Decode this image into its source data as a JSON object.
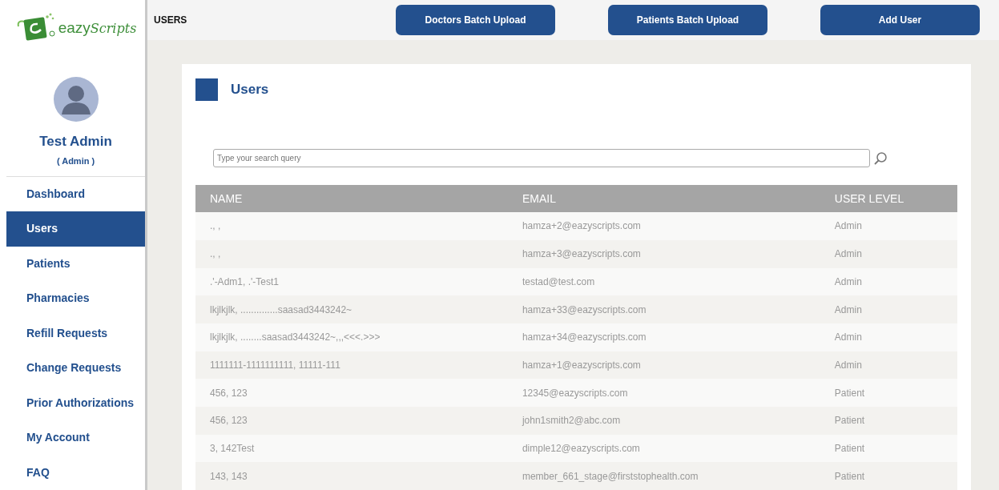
{
  "logo": {
    "text": "eazy",
    "script": "Scripts"
  },
  "profile": {
    "name": "Test Admin",
    "role": "( Admin )"
  },
  "sidebar": {
    "items": [
      {
        "label": "Dashboard",
        "selected": false
      },
      {
        "label": "Users",
        "selected": true
      },
      {
        "label": "Patients",
        "selected": false
      },
      {
        "label": "Pharmacies",
        "selected": false
      },
      {
        "label": "Refill Requests",
        "selected": false
      },
      {
        "label": "Change Requests",
        "selected": false
      },
      {
        "label": "Prior Authorizations",
        "selected": false
      },
      {
        "label": "My Account",
        "selected": false
      },
      {
        "label": "FAQ",
        "selected": false
      }
    ]
  },
  "header": {
    "title": "USERS",
    "buttons": [
      "Doctors Batch Upload",
      "Patients Batch Upload",
      "Add User"
    ]
  },
  "panel": {
    "title": "Users"
  },
  "search": {
    "placeholder": "Type your search query"
  },
  "table": {
    "columns": [
      "NAME",
      "EMAIL",
      "USER LEVEL"
    ],
    "rows": [
      [
        "., ,",
        "hamza+2@eazyscripts.com",
        "Admin"
      ],
      [
        "., ,",
        "hamza+3@eazyscripts.com",
        "Admin"
      ],
      [
        ".'-Adm1, .'-Test1",
        "testad@test.com",
        "Admin"
      ],
      [
        "lkjlkjlk, ..............saasad3443242~",
        "hamza+33@eazyscripts.com",
        "Admin"
      ],
      [
        "lkjlkjlk, ........saasad3443242~,,,<<<.>>>",
        "hamza+34@eazyscripts.com",
        "Admin"
      ],
      [
        "1111111-1111111111, 11111-111",
        "hamza+1@eazyscripts.com",
        "Admin"
      ],
      [
        "456, 123",
        "12345@eazyscripts.com",
        "Patient"
      ],
      [
        "456, 123",
        "john1smith2@abc.com",
        "Patient"
      ],
      [
        "3, 142Test",
        "dimple12@eazyscripts.com",
        "Patient"
      ],
      [
        "143, 143",
        "member_661_stage@firststophealth.com",
        "Patient"
      ]
    ]
  }
}
